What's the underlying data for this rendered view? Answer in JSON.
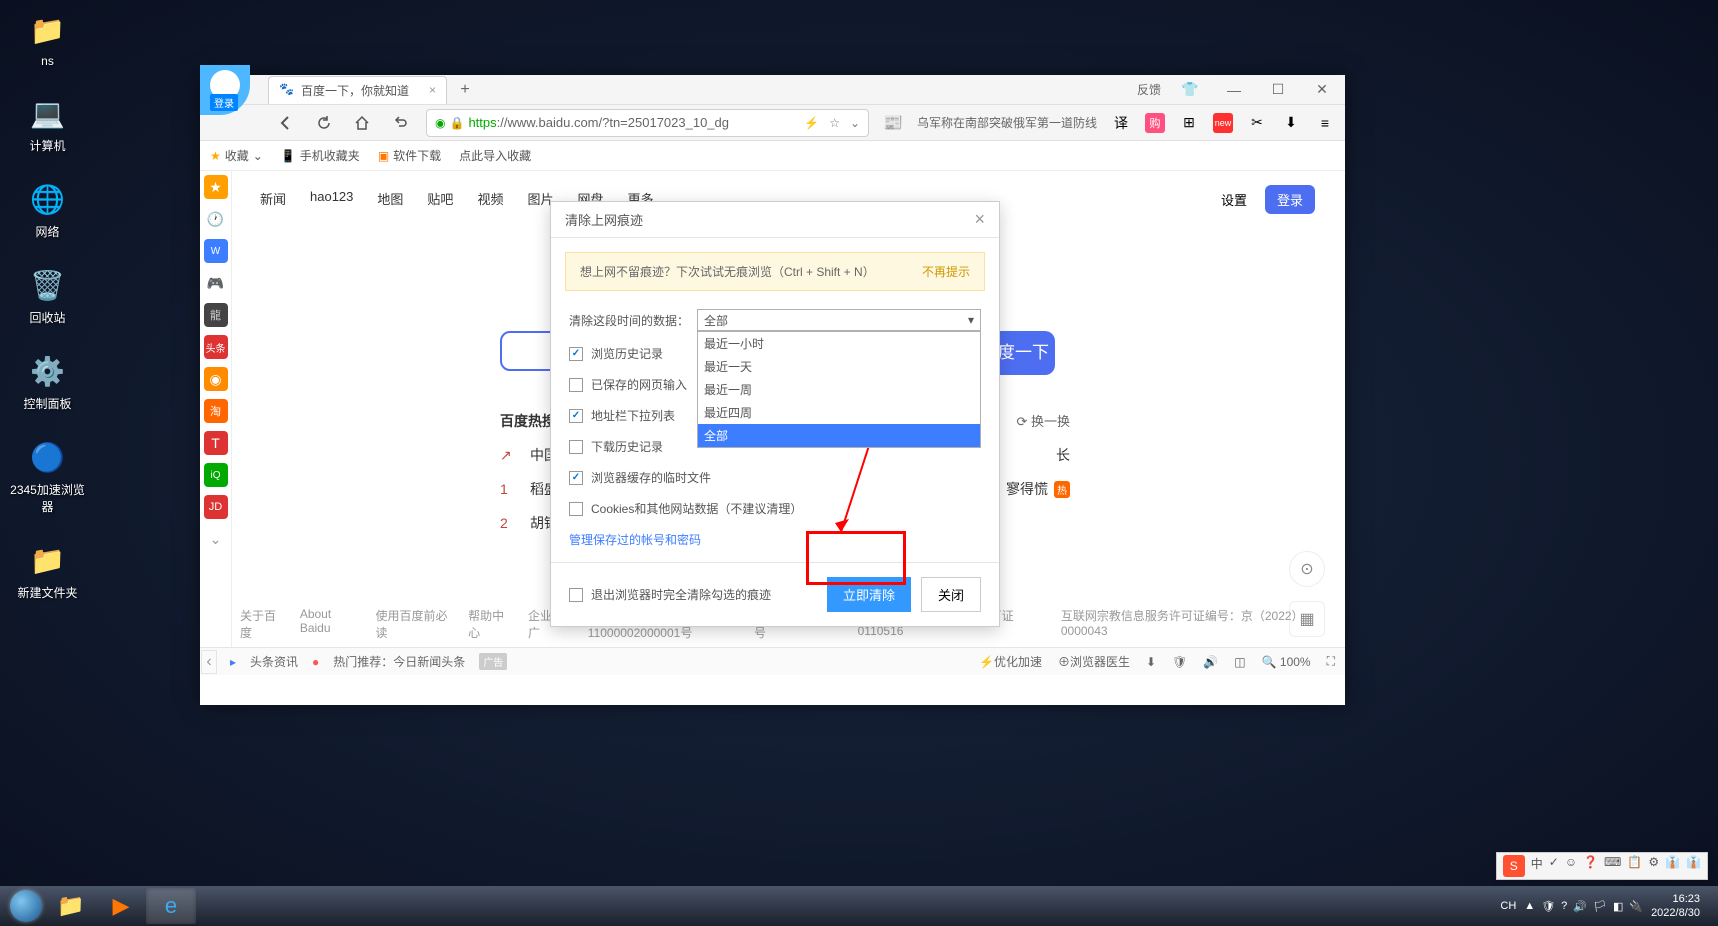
{
  "desktop": {
    "icons": [
      {
        "name": "ns",
        "emoji": "📁"
      },
      {
        "name": "计算机",
        "emoji": "💻"
      },
      {
        "name": "网络",
        "emoji": "🌐"
      },
      {
        "name": "回收站",
        "emoji": "🗑️"
      },
      {
        "name": "控制面板",
        "emoji": "⚙️"
      },
      {
        "name": "2345加速浏览器",
        "emoji": "🔵"
      },
      {
        "name": "新建文件夹",
        "emoji": "📁"
      }
    ]
  },
  "browser": {
    "tab_title": "百度一下，你就知道",
    "feedback": "反馈",
    "login_badge": "登录",
    "url_prefix": "https",
    "url_rest": "://www.baidu.com/?tn=25017023_10_dg",
    "url_hint": "乌军称在南部突破俄军第一道防线",
    "bookmarks": {
      "fav": "收藏",
      "mobile": "手机收藏夹",
      "software": "软件下载",
      "import": "点此导入收藏"
    }
  },
  "baidu": {
    "nav": [
      "新闻",
      "hao123",
      "地图",
      "贴吧",
      "视频",
      "图片",
      "网盘",
      "更多"
    ],
    "settings": "设置",
    "login": "登录",
    "search_btn": "百度一下",
    "hot_title": "百度热搜",
    "refresh": "换一换",
    "hot_items": [
      {
        "rank": "↗",
        "text": "中国",
        "rank_color": "#f13f3f"
      },
      {
        "rank": "1",
        "text": "稻盛",
        "extra": "寥得慌",
        "badge": "热"
      },
      {
        "rank": "2",
        "text": "胡锡",
        "extra": "长"
      }
    ],
    "footer": [
      "关于百度",
      "About Baidu",
      "使用百度前必读",
      "帮助中心",
      "企业推广",
      "京公网安备11000002000001号",
      "京ICP证030173号",
      "信息网络传播视听节目许可证 0110516",
      "互联网宗教信息服务许可证编号：京（2022）0000043"
    ]
  },
  "dialog": {
    "title": "清除上网痕迹",
    "banner_text": "想上网不留痕迹？下次试试无痕浏览（Ctrl + Shift + N）",
    "banner_dismiss": "不再提示",
    "time_label": "清除这段时间的数据：",
    "time_selected": "全部",
    "dropdown_options": [
      "最近一小时",
      "最近一天",
      "最近一周",
      "最近四周",
      "全部"
    ],
    "checkboxes": [
      {
        "label": "浏览历史记录",
        "checked": true
      },
      {
        "label": "已保存的网页输入",
        "checked": false
      },
      {
        "label": "地址栏下拉列表",
        "checked": true
      },
      {
        "label": "下载历史记录",
        "checked": false
      },
      {
        "label": "浏览器缓存的临时文件",
        "checked": true
      },
      {
        "label": "Cookies和其他网站数据（不建议清理）",
        "checked": false
      }
    ],
    "manage_link": "管理保存过的帐号和密码",
    "exit_checkbox": "退出浏览器时完全清除勾选的痕迹",
    "btn_clear": "立即清除",
    "btn_close": "关闭"
  },
  "statusbar": {
    "headlines": "头条资讯",
    "hot_rec": "热门推荐：今日新闻头条",
    "ad_tag": "广告",
    "optimize": "优化加速",
    "doctor": "浏览器医生",
    "zoom": "100%"
  },
  "ime": {
    "items": [
      "中",
      "✓",
      "☺",
      "❓",
      "⌨",
      "📋",
      "⚙",
      "👔",
      "👔"
    ]
  },
  "taskbar": {
    "time": "16:23",
    "date": "2022/8/30",
    "tray_ch": "CH",
    "tray_icons": [
      "▲",
      "🛡",
      "?",
      "🔊",
      "🏳",
      "◧",
      "🔌"
    ]
  }
}
